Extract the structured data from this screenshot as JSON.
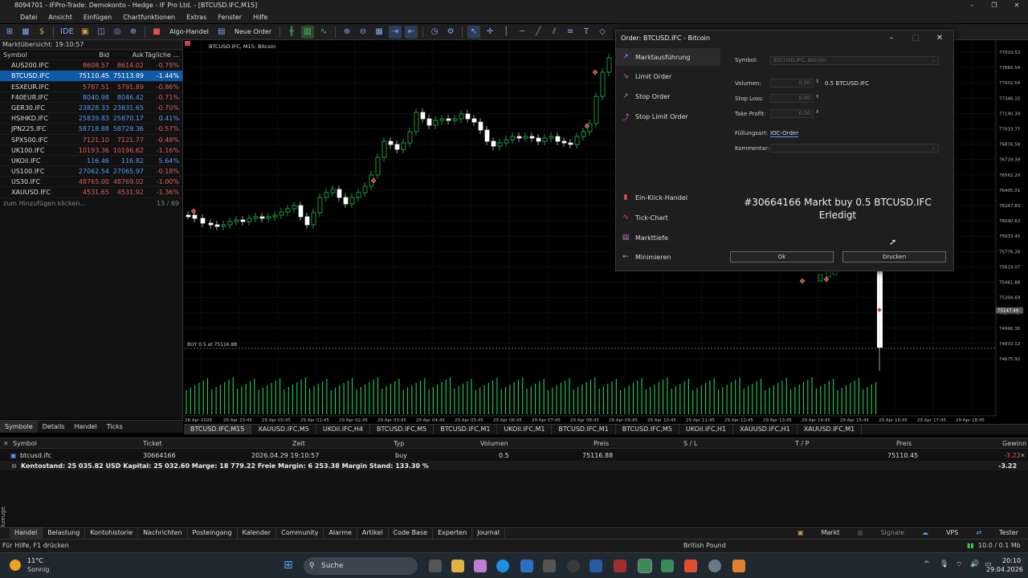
{
  "window": {
    "title": "8094701 - IFPro-Trade: Demokonto - Hedge - IF Pro Ltd. - [BTCUSD.IFC,M15]",
    "controls": [
      "–",
      "❐",
      "✕"
    ]
  },
  "menu": [
    "Datei",
    "Ansicht",
    "Einfügen",
    "Chartfunktionen",
    "Extras",
    "Fenster",
    "Hilfe"
  ],
  "toolbar": {
    "algo_label": "Algo-Handel",
    "new_order_label": "Neue Order"
  },
  "market_watch": {
    "title": "Marktübersicht: 19:10:57",
    "headers": {
      "symbol": "Symbol",
      "bid": "Bid",
      "ask": "Ask",
      "change": "Tägliche ..."
    },
    "rows": [
      {
        "symbol": "AUS200.IFC",
        "bid": "8608.57",
        "ask": "8614.02",
        "change": "-0.79%",
        "dir": "down"
      },
      {
        "symbol": "BTCUSD.IFC",
        "bid": "75110.45",
        "ask": "75113.89",
        "change": "-1.44%",
        "dir": "down",
        "selected": true
      },
      {
        "symbol": "ESXEUR.IFC",
        "bid": "5787.51",
        "ask": "5791.89",
        "change": "-0.86%",
        "dir": "down"
      },
      {
        "symbol": "F40EUR.IFC",
        "bid": "8040.98",
        "ask": "8046.42",
        "change": "-0.71%",
        "dir": "up"
      },
      {
        "symbol": "GER30.IFC",
        "bid": "23828.33",
        "ask": "23831.65",
        "change": "-0.70%",
        "dir": "up"
      },
      {
        "symbol": "HSIHKD.IFC",
        "bid": "25839.83",
        "ask": "25870.17",
        "change": "0.41%",
        "dir": "up"
      },
      {
        "symbol": "JPN225.IFC",
        "bid": "58718.88",
        "ask": "58729.36",
        "change": "-0.57%",
        "dir": "up"
      },
      {
        "symbol": "SPX500.IFC",
        "bid": "7121.10",
        "ask": "7121.77",
        "change": "-0.48%",
        "dir": "down"
      },
      {
        "symbol": "UK100.IFC",
        "bid": "10193.36",
        "ask": "10196.62",
        "change": "-1.16%",
        "dir": "down"
      },
      {
        "symbol": "UKOil.IFC",
        "bid": "116.46",
        "ask": "116.82",
        "change": "5.64%",
        "dir": "up"
      },
      {
        "symbol": "US100.IFC",
        "bid": "27062.54",
        "ask": "27065.97",
        "change": "-0.18%",
        "dir": "up"
      },
      {
        "symbol": "US30.IFC",
        "bid": "48765.00",
        "ask": "48769.02",
        "change": "-1.00%",
        "dir": "down"
      },
      {
        "symbol": "XAUUSD.IFC",
        "bid": "4531.65",
        "ask": "4531.92",
        "change": "-1.36%",
        "dir": "down"
      }
    ],
    "add_label": "zum Hinzufügen klicken...",
    "count": "13 / 69",
    "tabs": [
      "Symbole",
      "Details",
      "Handel",
      "Ticks"
    ]
  },
  "chart": {
    "label": "BTCUSD.IFC, M15:  Bitcoin",
    "buy_label": "BUY 0.5 at 75116.88",
    "price_axis": [
      "77819.52",
      "77665.54",
      "77502.54",
      "77346.15",
      "77190.39",
      "77033.77",
      "76876.58",
      "76719.39",
      "76562.20",
      "76405.01",
      "76247.83",
      "76090.63",
      "75933.45",
      "75776.26",
      "75619.07",
      "75461.88",
      "75304.69",
      "75147.49",
      "74990.30",
      "74833.12",
      "74675.92"
    ],
    "current_price": "75147.49",
    "time_axis": [
      "28 Apr 2026",
      "28 Apr 23:45",
      "29 Apr 00:45",
      "29 Apr 01:45",
      "29 Apr 02:45",
      "29 Apr 03:45",
      "29 Apr 04:45",
      "29 Apr 05:45",
      "29 Apr 06:45",
      "29 Apr 07:45",
      "29 Apr 08:45",
      "29 Apr 09:45",
      "29 Apr 10:45",
      "29 Apr 11:45",
      "29 Apr 12:45",
      "29 Apr 13:45",
      "29 Apr 14:45",
      "29 Apr 15:45",
      "29 Apr 16:45",
      "29 Apr 17:45",
      "29 Apr 18:45"
    ],
    "tabs": [
      "BTCUSD.IFC,M15",
      "XAUUSD.IFC,M5",
      "UKOil.IFC,H4",
      "BTCUSD.IFC,M5",
      "BTCUSD.IFC,M1",
      "UKOil.IFC,M1",
      "BTCUSD.IFC,M1",
      "BTCUSD.IFC,M5",
      "UKOil.IFC,H1",
      "XAUUSD.IFC,H1",
      "XAUUSD.IFC,M1"
    ]
  },
  "order_dialog": {
    "title": "Order: BTCUSD.IFC - Bitcoin",
    "menu": [
      {
        "label": "Marktausführung",
        "icon": "market-execution"
      },
      {
        "label": "Limit Order",
        "icon": "limit-order"
      },
      {
        "label": "Stop Order",
        "icon": "stop-order"
      },
      {
        "label": "Stop Limit Order",
        "icon": "stop-limit-order"
      }
    ],
    "menu2": [
      {
        "label": "Ein-Klick-Handel",
        "icon": "one-click"
      },
      {
        "label": "Tick-Chart",
        "icon": "tick-chart"
      },
      {
        "label": "Markttiefe",
        "icon": "market-depth"
      },
      {
        "label": "Minimieren",
        "icon": "minimize"
      }
    ],
    "symbol_label": "Symbol:",
    "symbol_value": "BTCUSD.IFC, Bitcoin",
    "volume_label": "Volumen:",
    "volume_value": "0.50",
    "volume_note": "0.5 BTCUSD.IFC",
    "sl_label": "Stop Loss:",
    "sl_value": "0.00",
    "tp_label": "Take Profit:",
    "tp_value": "0.00",
    "fill_label": "Füllungsart:",
    "fill_value": "IOC-Order",
    "comment_label": "Kommentar:",
    "result_line1": "#30664166 Markt buy 0.5 BTCUSD.IFC",
    "result_line2": "Erledigt",
    "ok_label": "Ok",
    "print_label": "Drucken"
  },
  "trade": {
    "headers": {
      "symbol": "Symbol",
      "ticket": "Ticket",
      "time": "Zeit",
      "type": "Typ",
      "volume": "Volumen",
      "price": "Preis",
      "sl": "S / L",
      "tp": "T / P",
      "price2": "Preis",
      "profit": "Gewinn"
    },
    "row": {
      "symbol": "btcusd.ifc",
      "ticket": "30664166",
      "time": "2026.04.29 19:10:57",
      "type": "buy",
      "volume": "0.5",
      "price": "75116.88",
      "price2": "75110.45",
      "profit": "-3.22"
    },
    "balance": "Kontostand: 25 035.82 USD  Kapital: 25 032.60  Marge: 18 779.22  Freie Margin: 6 253.38  Margin Stand: 133.30 %",
    "balance_profit": "-3.22"
  },
  "bottom_tabs": [
    "Handel",
    "Belastung",
    "Kontohistorie",
    "Nachrichten",
    "Posteingang",
    "Kalender",
    "Community",
    "Alarme",
    "Artikel",
    "Code Base",
    "Experten",
    "Journal"
  ],
  "bottom_right": [
    "Markt",
    "Signale",
    "VPS",
    "Tester"
  ],
  "side_label": "Werkzeuge",
  "status": {
    "help": "Für Hilfe, F1 drücken",
    "currency": "British Pound",
    "traffic": "10.0 / 0.1 Mb"
  },
  "taskbar": {
    "temp": "11°C",
    "weather": "Sonnig",
    "search": "Suche",
    "time": "20:10",
    "date": "29.04.2026"
  },
  "colors": {
    "bull": "#1fd35a",
    "bear": "#ffffff",
    "accent": "#0e59a8",
    "down": "#e06060",
    "up": "#5b9bff"
  }
}
